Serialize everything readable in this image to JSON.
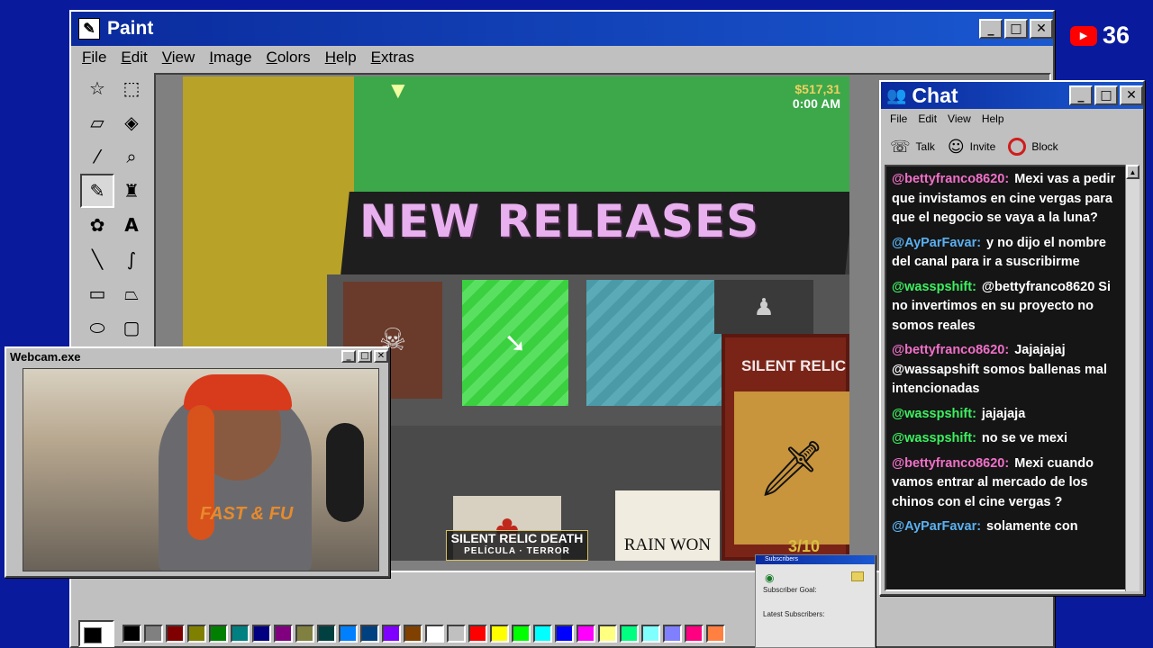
{
  "paint": {
    "title": "Paint",
    "menu": [
      "File",
      "Edit",
      "View",
      "Image",
      "Colors",
      "Help",
      "Extras"
    ],
    "tools": [
      "free-select",
      "rect-select",
      "eraser",
      "fill",
      "color-picker",
      "magnifier",
      "pencil",
      "brush",
      "airbrush",
      "text",
      "line",
      "curve",
      "rectangle",
      "polygon",
      "ellipse",
      "rounded-rect"
    ],
    "palette": [
      "#000000",
      "#808080",
      "#800000",
      "#808000",
      "#008000",
      "#008080",
      "#000080",
      "#800080",
      "#808040",
      "#004040",
      "#0080ff",
      "#004080",
      "#8000ff",
      "#804000",
      "#ffffff",
      "#c0c0c0",
      "#ff0000",
      "#ffff00",
      "#00ff00",
      "#00ffff",
      "#0000ff",
      "#ff00ff",
      "#ffff80",
      "#00ff80",
      "#80ffff",
      "#8080ff",
      "#ff0080",
      "#ff8040"
    ]
  },
  "game": {
    "money": "$517,31",
    "time": "0:00 AM",
    "sign": "NEW RELEASES",
    "relic_title": "SILENT RELIC",
    "rain_title": "RAIN WON",
    "caption_title": "SILENT RELIC DEATH",
    "caption_sub": "PELÍCULA · TERROR",
    "rating": "3/10"
  },
  "webcam": {
    "title": "Webcam.exe",
    "shirt_text": "FAST & FU"
  },
  "chat": {
    "title": "Chat",
    "menu": [
      "File",
      "Edit",
      "View",
      "Help"
    ],
    "talk": "Talk",
    "invite": "Invite",
    "block": "Block",
    "messages": [
      {
        "user": "@bettyfranco8620:",
        "text": "Mexi vas a pedir que invistamos en cine vergas para que el negocio se vaya a la luna?",
        "color": "pink"
      },
      {
        "user": "@AyParFavar:",
        "text": "y no dijo el nombre del canal para ir a suscribirme",
        "color": "blue"
      },
      {
        "user": "@wasspshift:",
        "text": "@bettyfranco8620 Si no invertimos en su proyecto no somos reales",
        "color": "green"
      },
      {
        "user": "@bettyfranco8620:",
        "text": "Jajajajaj @wassapshift somos ballenas mal intencionadas",
        "color": "pink"
      },
      {
        "user": "@wasspshift:",
        "text": "jajajaja",
        "color": "green"
      },
      {
        "user": "@wasspshift:",
        "text": "no se ve mexi",
        "color": "green"
      },
      {
        "user": "@bettyfranco8620:",
        "text": "Mexi cuando vamos entrar al mercado de los chinos con el cine vergas ?",
        "color": "pink"
      },
      {
        "user": "@AyParFavar:",
        "text": "solamente con",
        "color": "blue"
      }
    ]
  },
  "subscribers": {
    "title": "Subscribers",
    "goal": "Subscriber Goal:",
    "latest": "Latest Subscribers:"
  },
  "youtube": {
    "count": "36"
  }
}
